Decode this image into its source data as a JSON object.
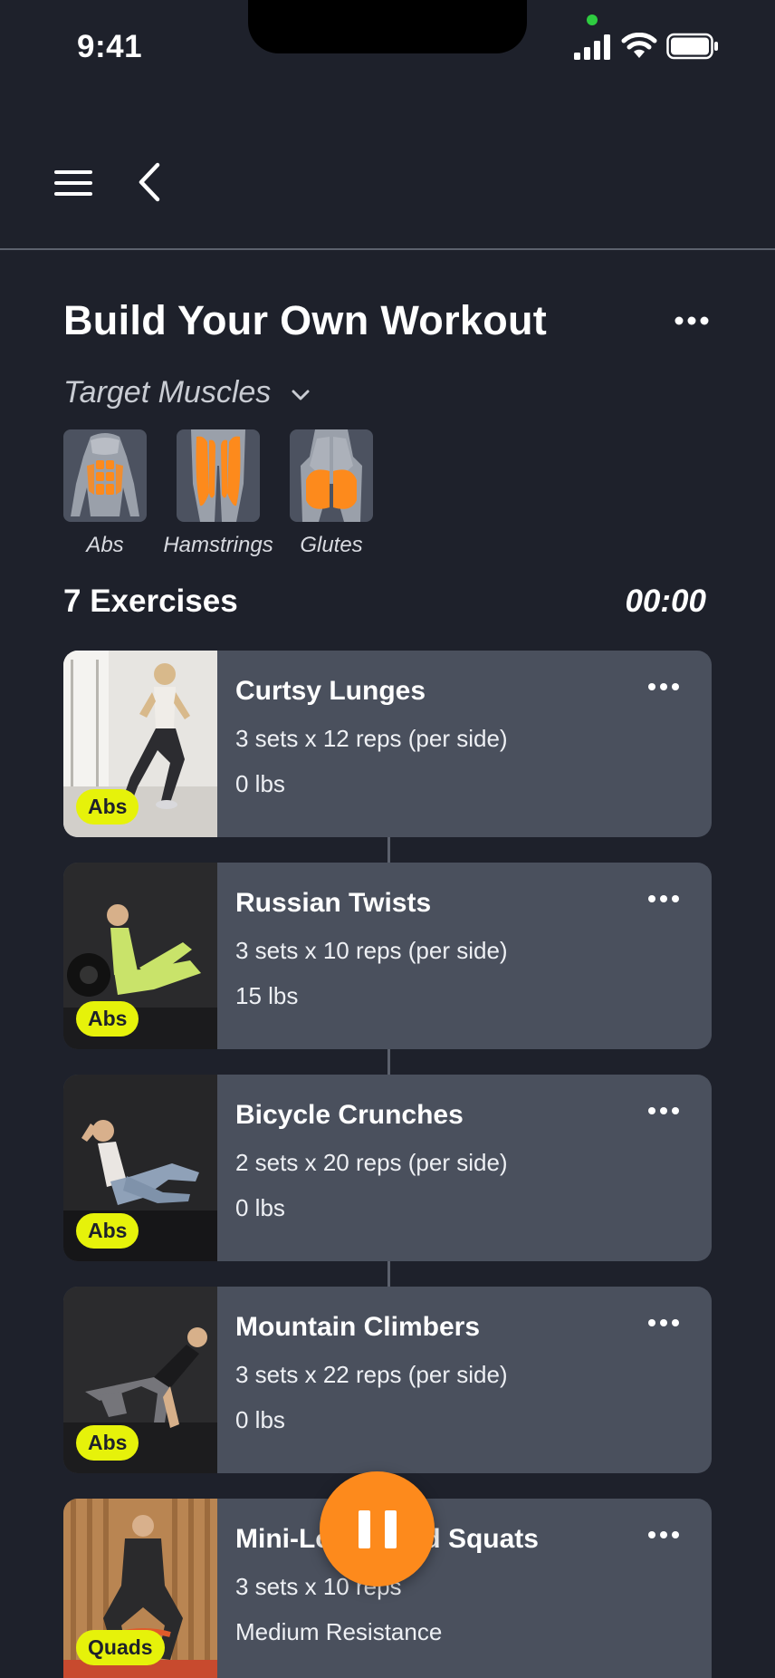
{
  "status_bar": {
    "time": "9:41"
  },
  "page": {
    "title": "Build Your Own Workout"
  },
  "target_muscles": {
    "label": "Target Muscles",
    "items": [
      {
        "label": "Abs",
        "icon": "abs-muscle-icon"
      },
      {
        "label": "Hamstrings",
        "icon": "hamstrings-muscle-icon"
      },
      {
        "label": "Glutes",
        "icon": "glutes-muscle-icon"
      }
    ]
  },
  "summary": {
    "count": "7 Exercises",
    "timer": "00:00"
  },
  "exercises": [
    {
      "name": "Curtsy Lunges",
      "sets": "3 sets x 12 reps (per side)",
      "weight": "0 lbs",
      "tag": "Abs"
    },
    {
      "name": "Russian Twists",
      "sets": "3 sets x 10 reps (per side)",
      "weight": "15 lbs",
      "tag": "Abs"
    },
    {
      "name": "Bicycle Crunches",
      "sets": "2 sets x 20 reps (per side)",
      "weight": "0 lbs",
      "tag": "Abs"
    },
    {
      "name": "Mountain Climbers",
      "sets": "3 sets x 22 reps (per side)",
      "weight": "0 lbs",
      "tag": "Abs"
    },
    {
      "name": "Mini-Loop Band Squats",
      "sets": "3 sets x 10 reps",
      "weight": "Medium Resistance",
      "tag": "Quads"
    }
  ],
  "colors": {
    "background": "#1e212b",
    "card": "#4a505d",
    "accent": "#fd8a1c",
    "tag": "#e6f20a"
  }
}
